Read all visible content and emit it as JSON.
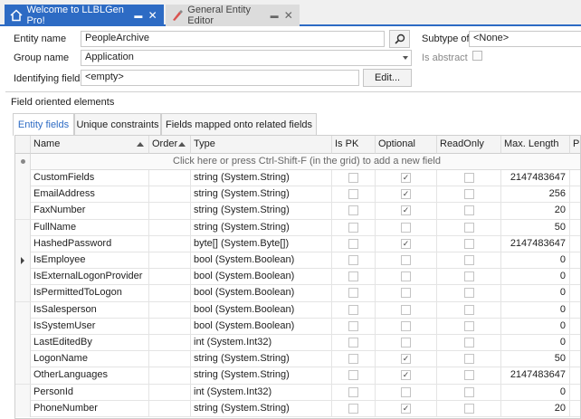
{
  "tabs": [
    {
      "label": "Welcome to LLBLGen Pro!",
      "icon": "home-icon",
      "active": true
    },
    {
      "label": "General Entity Editor",
      "icon": "entity-editor-icon",
      "active": false
    }
  ],
  "form": {
    "entity_name_label": "Entity name",
    "entity_name_value": "PeopleArchive",
    "group_name_label": "Group name",
    "group_name_value": "Application",
    "identifying_fields_label": "Identifying fields",
    "identifying_fields_value": "<empty>",
    "edit_button": "Edit...",
    "subtype_label": "Subtype of",
    "subtype_value": "<None>",
    "is_abstract_label": "Is abstract"
  },
  "group": {
    "title": "Field oriented elements"
  },
  "subtabs": [
    "Entity fields",
    "Unique constraints",
    "Fields mapped onto related fields"
  ],
  "grid": {
    "columns": [
      "Name",
      "Order",
      "Type",
      "Is PK",
      "Optional",
      "ReadOnly",
      "Max. Length",
      "Pr"
    ],
    "new_row_hint": "Click here or press Ctrl-Shift-F (in the grid) to add a new field",
    "rows": [
      {
        "name": "CustomFields",
        "type": "string (System.String)",
        "optional": true,
        "max_length": "2147483647",
        "current": false
      },
      {
        "name": "EmailAddress",
        "type": "string (System.String)",
        "optional": true,
        "max_length": "256",
        "current": false
      },
      {
        "name": "FaxNumber",
        "type": "string (System.String)",
        "optional": true,
        "max_length": "20",
        "current": false
      },
      {
        "name": "FullName",
        "type": "string (System.String)",
        "optional": false,
        "max_length": "50",
        "current": false
      },
      {
        "name": "HashedPassword",
        "type": "byte[] (System.Byte[])",
        "optional": true,
        "max_length": "2147483647",
        "current": false
      },
      {
        "name": "IsEmployee",
        "type": "bool (System.Boolean)",
        "optional": false,
        "max_length": "0",
        "current": true
      },
      {
        "name": "IsExternalLogonProvider",
        "type": "bool (System.Boolean)",
        "optional": false,
        "max_length": "0",
        "current": false
      },
      {
        "name": "IsPermittedToLogon",
        "type": "bool (System.Boolean)",
        "optional": false,
        "max_length": "0",
        "current": false
      },
      {
        "name": "IsSalesperson",
        "type": "bool (System.Boolean)",
        "optional": false,
        "max_length": "0",
        "current": false
      },
      {
        "name": "IsSystemUser",
        "type": "bool (System.Boolean)",
        "optional": false,
        "max_length": "0",
        "current": false
      },
      {
        "name": "LastEditedBy",
        "type": "int (System.Int32)",
        "optional": false,
        "max_length": "0",
        "current": false
      },
      {
        "name": "LogonName",
        "type": "string (System.String)",
        "optional": true,
        "max_length": "50",
        "current": false
      },
      {
        "name": "OtherLanguages",
        "type": "string (System.String)",
        "optional": true,
        "max_length": "2147483647",
        "current": false
      },
      {
        "name": "PersonId",
        "type": "int (System.Int32)",
        "optional": false,
        "max_length": "0",
        "current": false
      },
      {
        "name": "PhoneNumber",
        "type": "string (System.String)",
        "optional": true,
        "max_length": "20",
        "current": false
      }
    ]
  },
  "colors": {
    "accent": "#2d6bc4",
    "tab_inactive": "#dcdcdc"
  }
}
